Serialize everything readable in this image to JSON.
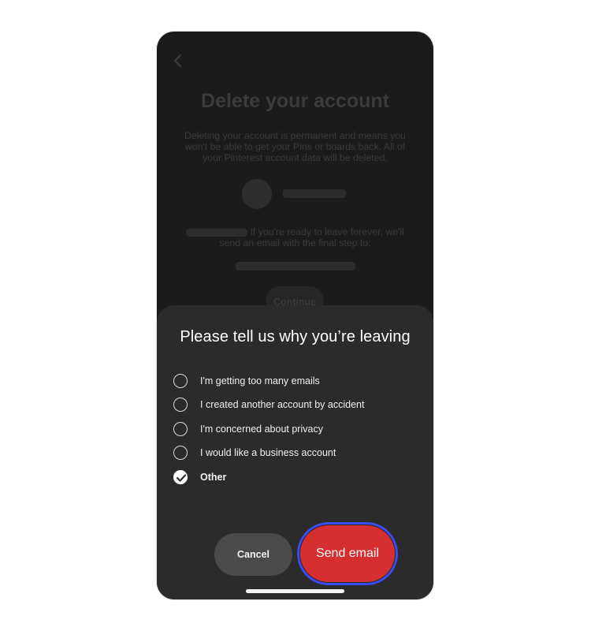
{
  "background_page": {
    "title": "Delete your account",
    "description": "Deleting your account is permanent and means you won't be able to get your Pins or boards back. All of your Pinterest account data will be deleted.",
    "info_text": "If you're ready to leave forever, we'll send an email with the final step to:",
    "continue_label": "Continue"
  },
  "sheet": {
    "title": "Please tell us why you’re leaving",
    "options": [
      {
        "label": "I'm getting too many emails",
        "checked": false
      },
      {
        "label": "I created another account by accident",
        "checked": false
      },
      {
        "label": "I'm concerned about privacy",
        "checked": false
      },
      {
        "label": "I would like a business account",
        "checked": false
      },
      {
        "label": "Other",
        "checked": true
      }
    ],
    "cancel_label": "Cancel",
    "send_label": "Send email"
  },
  "colors": {
    "accent_red": "#d72f30",
    "focus_ring": "#3a4bf2",
    "sheet_bg": "#2b2b2b"
  },
  "icons": [
    "chevron-left-icon",
    "checkmark-icon"
  ]
}
